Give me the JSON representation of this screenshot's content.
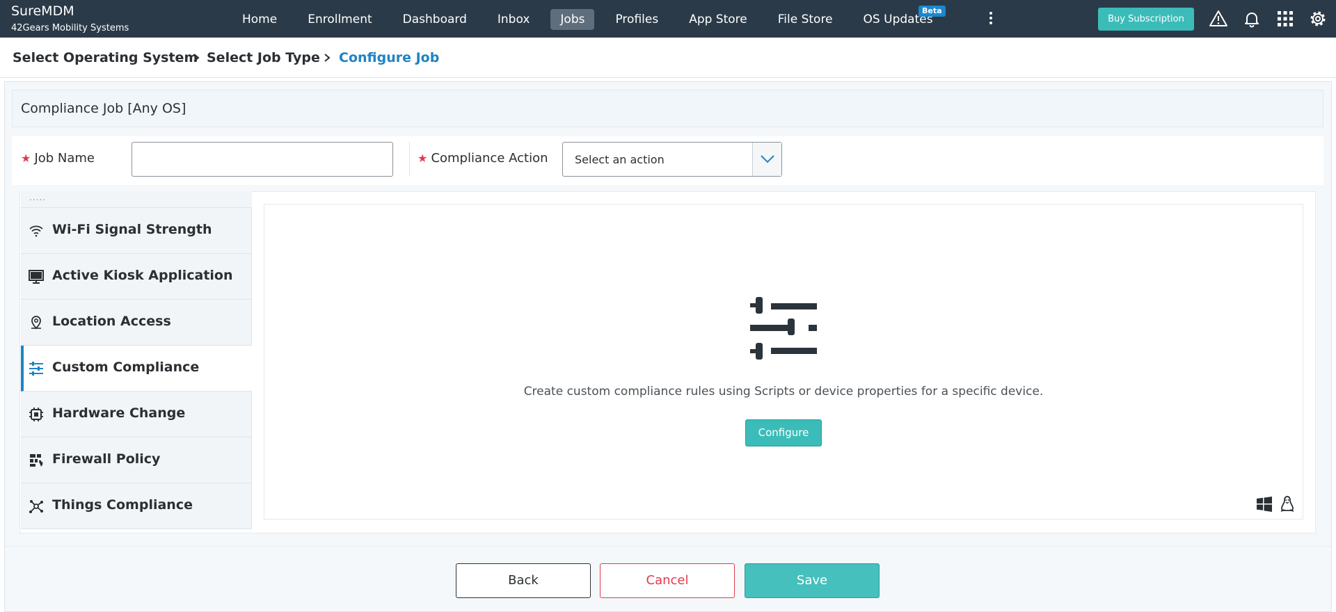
{
  "app": {
    "name": "SureMDM",
    "org": "42Gears Mobility Systems"
  },
  "nav": {
    "items": [
      {
        "label": "Home"
      },
      {
        "label": "Enrollment"
      },
      {
        "label": "Dashboard"
      },
      {
        "label": "Inbox"
      },
      {
        "label": "Jobs",
        "active": true
      },
      {
        "label": "Profiles"
      },
      {
        "label": "App Store"
      },
      {
        "label": "File Store"
      },
      {
        "label": "OS Updates",
        "badge": "Beta"
      }
    ],
    "buy_label": "Buy Subscription",
    "icons": [
      "more-vertical-icon",
      "warning-icon",
      "bell-icon",
      "apps-grid-icon",
      "gear-icon"
    ]
  },
  "breadcrumb": {
    "steps": [
      "Select Operating System",
      "Select Job Type",
      "Configure Job"
    ]
  },
  "section": {
    "title": "Compliance Job [Any OS]"
  },
  "form": {
    "job_name_label": "Job Name",
    "job_name_value": "",
    "action_label": "Compliance Action",
    "action_value": "Select an action"
  },
  "sidebar": {
    "top_stub": ".....",
    "items": [
      {
        "label": "Wi-Fi Signal Strength",
        "icon": "wifi-icon"
      },
      {
        "label": "Active Kiosk Application",
        "icon": "monitor-icon"
      },
      {
        "label": "Location Access",
        "icon": "location-pin-icon"
      },
      {
        "label": "Custom Compliance",
        "icon": "sliders-icon",
        "active": true
      },
      {
        "label": "Hardware Change",
        "icon": "chip-icon"
      },
      {
        "label": "Firewall Policy",
        "icon": "firewall-icon"
      },
      {
        "label": "Things Compliance",
        "icon": "network-nodes-icon"
      }
    ]
  },
  "detail": {
    "icon": "sliders-icon",
    "description": "Create custom compliance rules using Scripts or device properties for a specific device.",
    "configure_label": "Configure",
    "os_icons": [
      "windows-icon",
      "linux-icon"
    ]
  },
  "footer": {
    "back_label": "Back",
    "cancel_label": "Cancel",
    "save_label": "Save"
  },
  "colors": {
    "topbar": "#2b3a48",
    "accent": "#3bbcb8",
    "link": "#1e83c5",
    "danger": "#e03a4e"
  }
}
